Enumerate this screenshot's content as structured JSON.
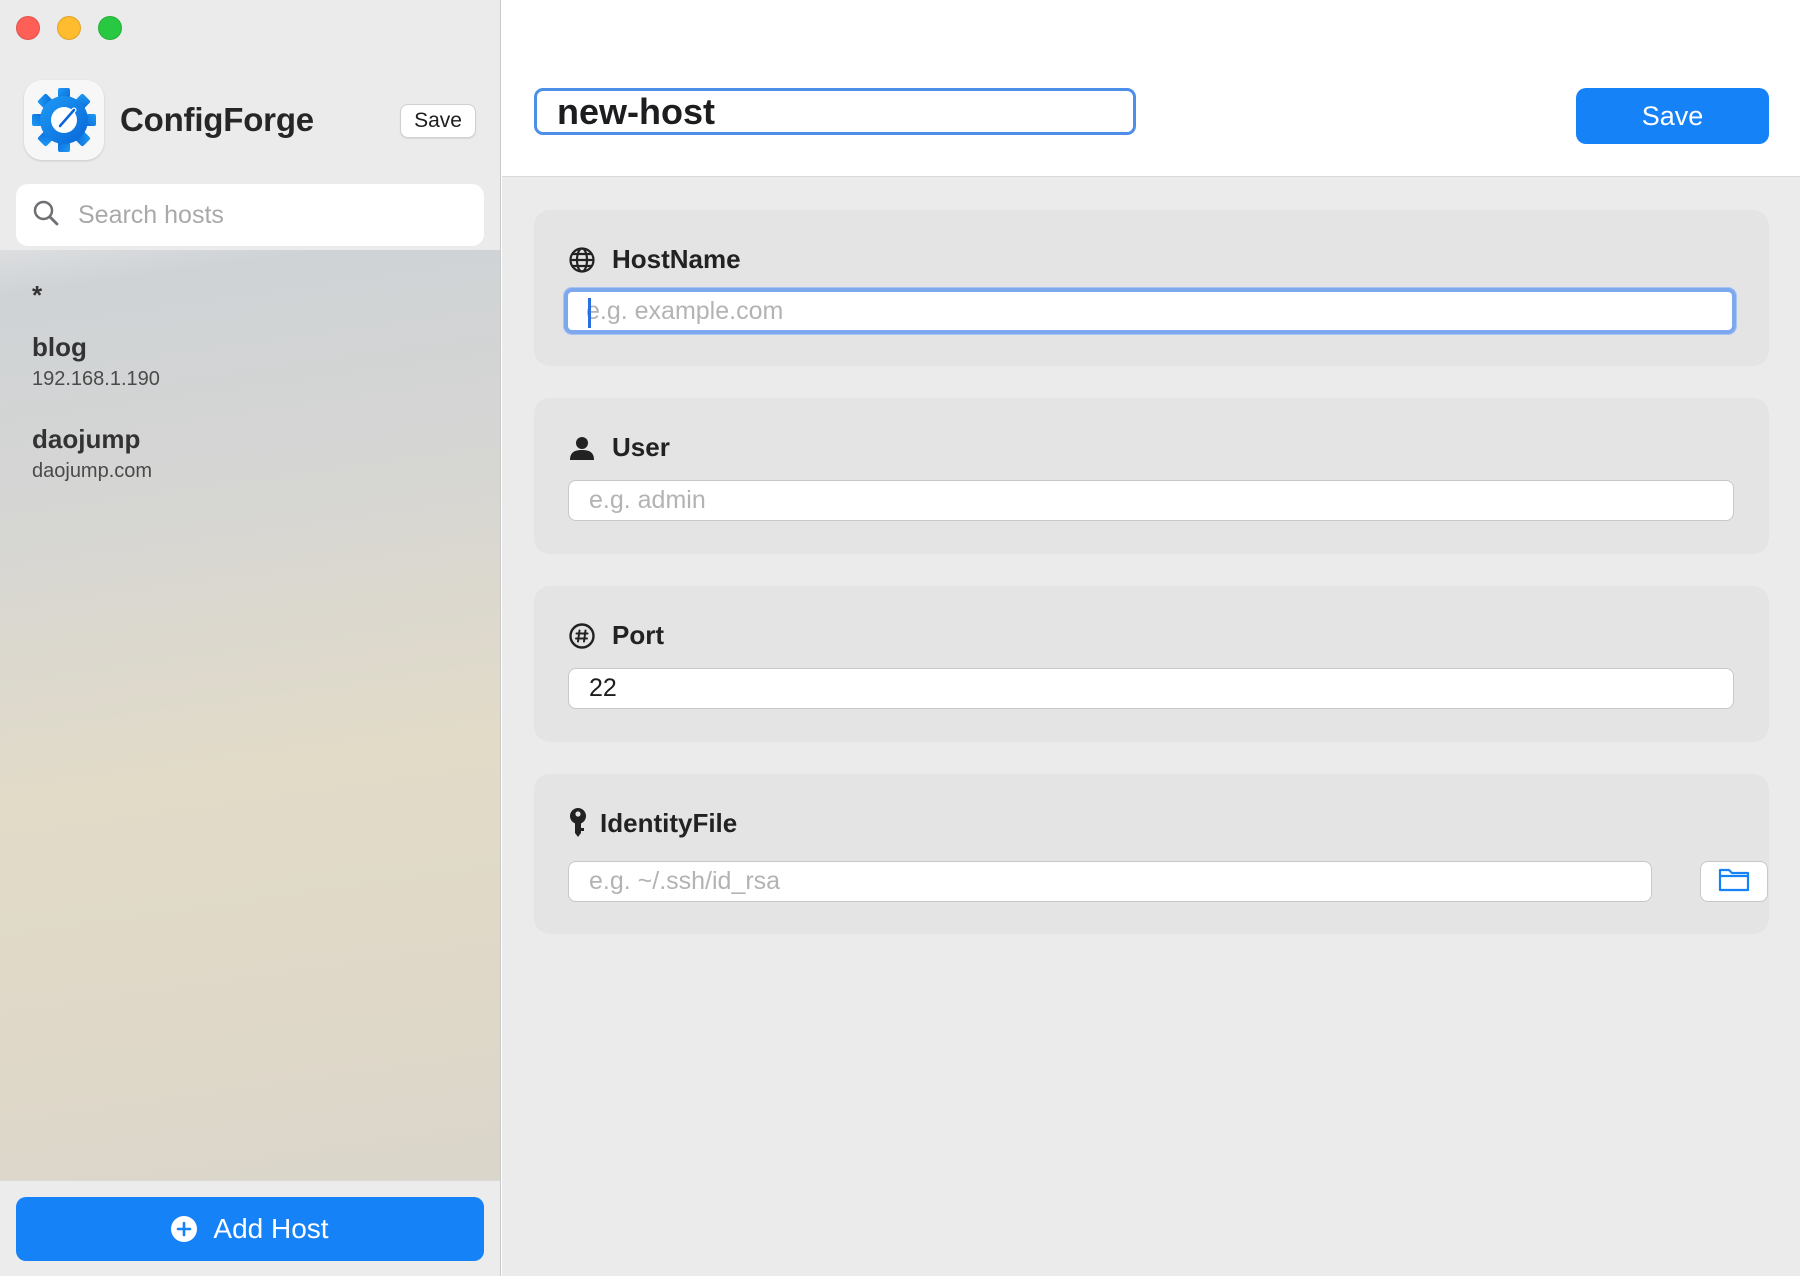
{
  "window": {
    "controls": [
      "close",
      "minimize",
      "maximize"
    ]
  },
  "sidebar": {
    "app_name": "ConfigForge",
    "app_icon": "gear-icon",
    "save_label": "Save",
    "search": {
      "placeholder": "Search hosts",
      "value": ""
    },
    "hosts": [
      {
        "name": "*",
        "address": ""
      },
      {
        "name": "blog",
        "address": "192.168.1.190"
      },
      {
        "name": "daojump",
        "address": "daojump.com"
      }
    ],
    "add_host_label": "Add Host"
  },
  "editor": {
    "host_alias": "new-host",
    "save_label": "Save",
    "fields": {
      "hostname": {
        "label": "HostName",
        "icon": "globe-icon",
        "placeholder": "e.g. example.com",
        "value": ""
      },
      "user": {
        "label": "User",
        "icon": "person-icon",
        "placeholder": "e.g. admin",
        "value": ""
      },
      "port": {
        "label": "Port",
        "icon": "number-circle-icon",
        "placeholder": "",
        "value": "22"
      },
      "identity_file": {
        "label": "IdentityFile",
        "icon": "key-icon",
        "placeholder": "e.g. ~/.ssh/id_rsa",
        "value": "",
        "browse_icon": "folder-icon"
      }
    }
  },
  "colors": {
    "accent": "#1682f8",
    "focus_ring": "#7ea8ee",
    "traffic_close": "#ff5f57",
    "traffic_minimize": "#febc2e",
    "traffic_maximize": "#28c840"
  }
}
